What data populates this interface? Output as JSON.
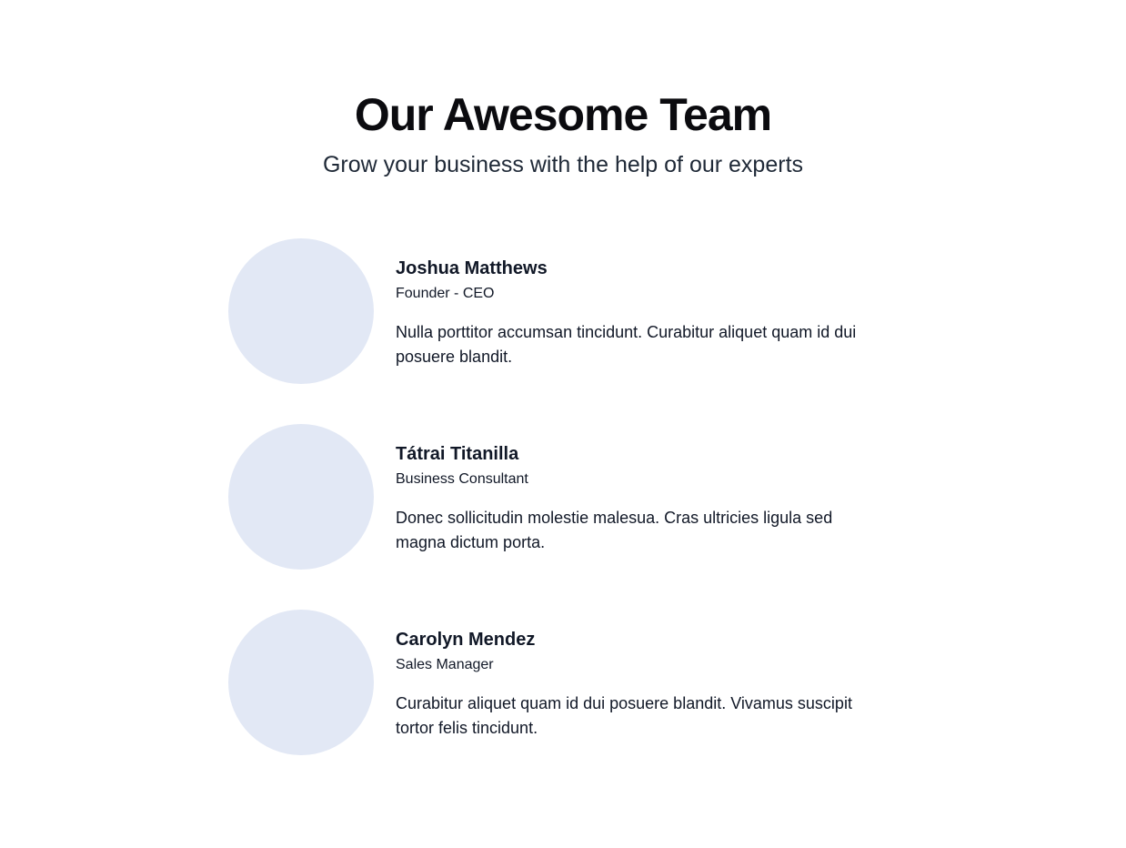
{
  "header": {
    "title": "Our Awesome Team",
    "subtitle": "Grow your business with the help of our experts"
  },
  "team": [
    {
      "name": "Joshua Matthews",
      "role": "Founder - CEO",
      "bio": "Nulla porttitor accumsan tincidunt. Curabitur aliquet quam id dui posuere blandit."
    },
    {
      "name": "Tátrai Titanilla",
      "role": "Business Consultant",
      "bio": "Donec sollicitudin molestie malesua. Cras ultricies ligula sed magna dictum porta."
    },
    {
      "name": "Carolyn Mendez",
      "role": "Sales Manager",
      "bio": "Curabitur aliquet quam id dui posuere blandit. Vivamus suscipit tortor felis tincidunt."
    }
  ],
  "colors": {
    "avatar_placeholder": "#e2e8f5",
    "text": "#111827",
    "background": "#ffffff"
  }
}
